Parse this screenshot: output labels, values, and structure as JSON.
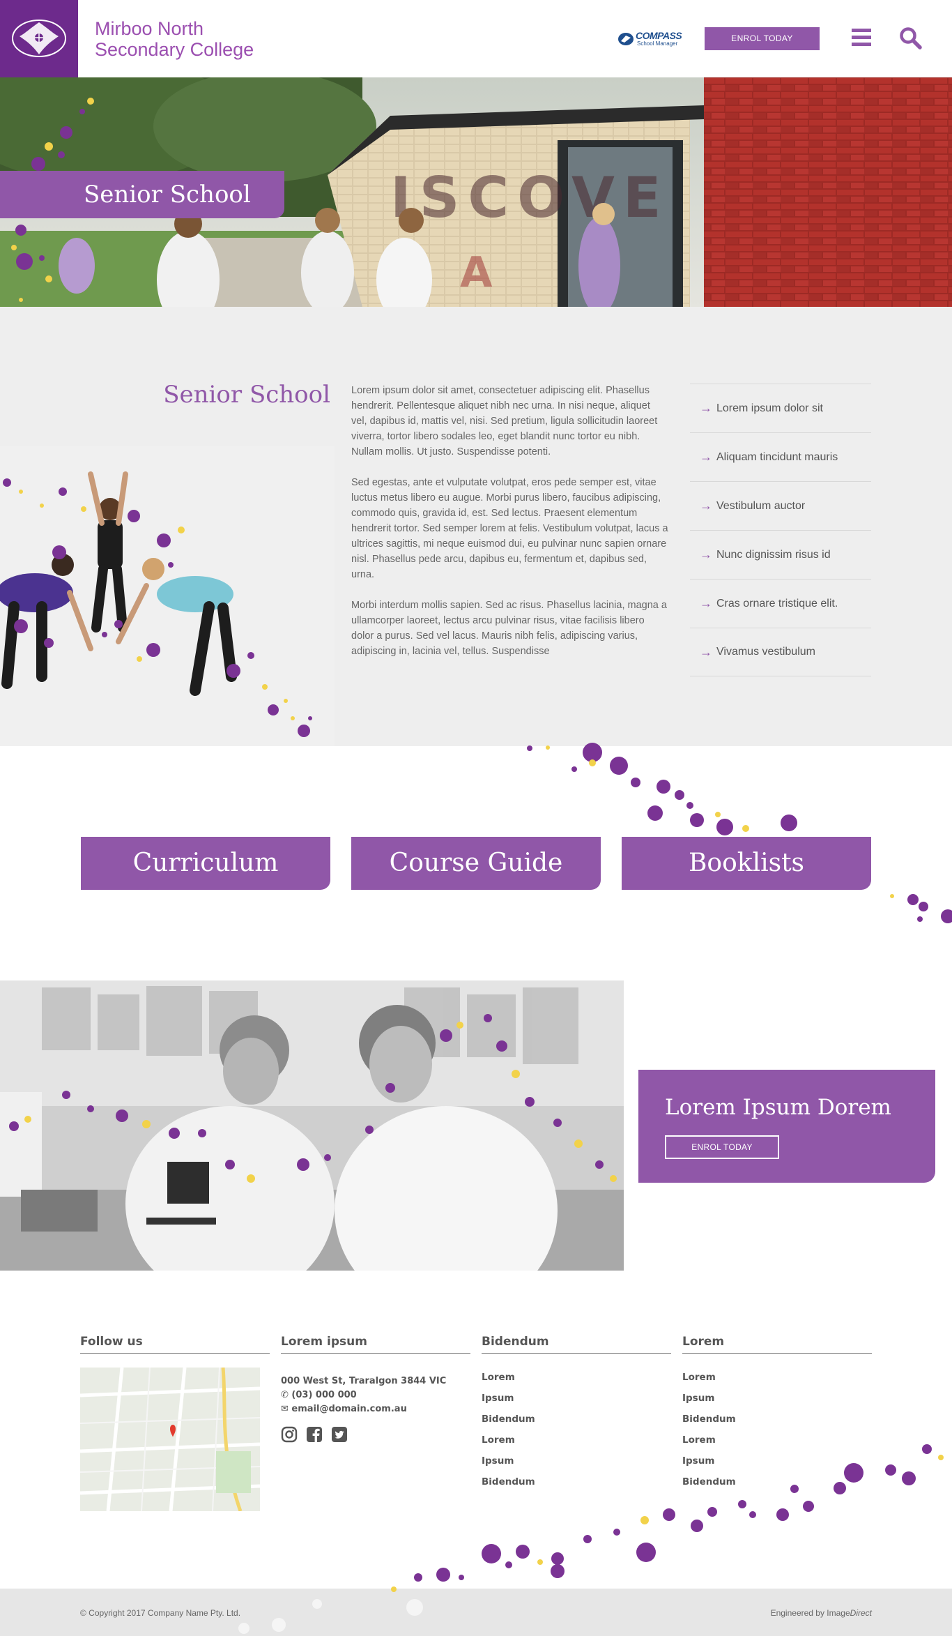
{
  "header": {
    "brand_line1": "Mirboo North",
    "brand_line2": "Secondary College",
    "compass_title": "COMPASS",
    "compass_sub": "School Manager",
    "enrol_label": "ENROL TODAY"
  },
  "hero": {
    "title": "Senior School"
  },
  "content": {
    "title": "Senior School",
    "paragraphs": [
      "Lorem ipsum dolor sit amet, consectetuer adipiscing elit. Phasellus hendrerit. Pellentesque aliquet nibh nec urna. In nisi neque, aliquet vel, dapibus id, mattis vel, nisi. Sed pretium, ligula sollicitudin laoreet viverra, tortor libero sodales leo, eget blandit nunc tortor eu nibh. Nullam mollis. Ut justo. Suspendisse potenti.",
      "Sed egestas, ante et vulputate volutpat, eros pede semper est, vitae luctus metus libero eu augue. Morbi purus libero, faucibus adipiscing, commodo quis, gravida id, est. Sed lectus. Praesent elementum hendrerit tortor. Sed semper lorem at felis. Vestibulum volutpat, lacus a ultrices sagittis, mi neque euismod dui, eu pulvinar nunc sapien ornare nisl. Phasellus pede arcu, dapibus eu, fermentum et, dapibus sed, urna.",
      "Morbi interdum mollis sapien. Sed ac risus. Phasellus lacinia, magna a ullamcorper laoreet, lectus arcu pulvinar risus, vitae facilisis libero dolor a purus. Sed vel lacus. Mauris nibh felis, adipiscing varius, adipiscing in, lacinia vel, tellus. Suspendisse"
    ],
    "side_links": [
      "Lorem ipsum dolor sit",
      "Aliquam tincidunt mauris",
      "Vestibulum auctor",
      "Nunc dignissim risus id",
      "Cras ornare tristique elit.",
      "Vivamus vestibulum"
    ]
  },
  "buttons": [
    "Curriculum",
    "Course Guide",
    "Booklists"
  ],
  "callout": {
    "title": "Lorem Ipsum Dorem",
    "button": "ENROL TODAY"
  },
  "footer": {
    "col1_head": "Follow us",
    "col2_head": "Lorem ipsum",
    "address": "000 West St, Traralgon 3844 VIC",
    "phone": "(03) 000 000",
    "email": "email@domain.com.au",
    "col3_head": "Bidendum",
    "col3_links": [
      "Lorem",
      "Ipsum",
      "Bidendum",
      "Lorem",
      "Ipsum",
      "Bidendum"
    ],
    "col4_head": "Lorem",
    "col4_links": [
      "Lorem",
      "Ipsum",
      "Bidendum",
      "Lorem",
      "Ipsum",
      "Bidendum"
    ],
    "copyright": "© Copyright 2017  Company Name Pty. Ltd.",
    "engineered_prefix": "Engineered by Image",
    "engineered_suffix": "Direct"
  },
  "colors": {
    "brand_purple": "#9057a8",
    "dark_purple": "#6d2a8c",
    "dot_yellow": "#f2d24a",
    "grey_bg": "#eeeeee"
  }
}
